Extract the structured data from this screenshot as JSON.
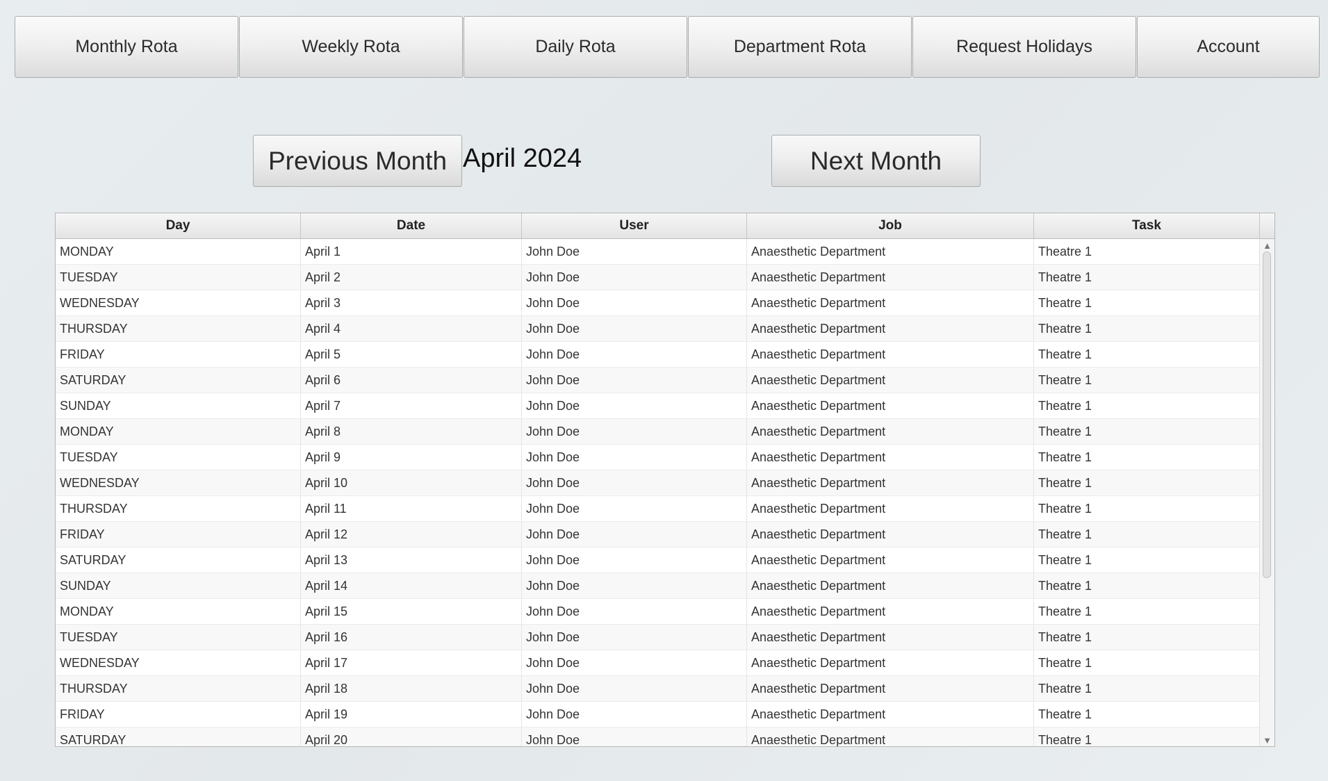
{
  "nav": {
    "tabs": [
      {
        "label": "Monthly Rota"
      },
      {
        "label": "Weekly Rota"
      },
      {
        "label": "Daily Rota"
      },
      {
        "label": "Department Rota"
      },
      {
        "label": "Request Holidays"
      },
      {
        "label": "Account"
      }
    ]
  },
  "month_nav": {
    "prev_label": "Previous Month",
    "current_month": "April 2024",
    "next_label": "Next Month"
  },
  "table": {
    "headers": {
      "day": "Day",
      "date": "Date",
      "user": "User",
      "job": "Job",
      "task": "Task"
    },
    "rows": [
      {
        "day": "MONDAY",
        "date": "April 1",
        "user": "John Doe",
        "job": "Anaesthetic Department",
        "task": "Theatre 1"
      },
      {
        "day": "TUESDAY",
        "date": "April 2",
        "user": "John Doe",
        "job": "Anaesthetic Department",
        "task": "Theatre 1"
      },
      {
        "day": "WEDNESDAY",
        "date": "April 3",
        "user": "John Doe",
        "job": "Anaesthetic Department",
        "task": "Theatre 1"
      },
      {
        "day": "THURSDAY",
        "date": "April 4",
        "user": "John Doe",
        "job": "Anaesthetic Department",
        "task": "Theatre 1"
      },
      {
        "day": "FRIDAY",
        "date": "April 5",
        "user": "John Doe",
        "job": "Anaesthetic Department",
        "task": "Theatre 1"
      },
      {
        "day": "SATURDAY",
        "date": "April 6",
        "user": "John Doe",
        "job": "Anaesthetic Department",
        "task": "Theatre 1"
      },
      {
        "day": "SUNDAY",
        "date": "April 7",
        "user": "John Doe",
        "job": "Anaesthetic Department",
        "task": "Theatre 1"
      },
      {
        "day": "MONDAY",
        "date": "April 8",
        "user": "John Doe",
        "job": "Anaesthetic Department",
        "task": "Theatre 1"
      },
      {
        "day": "TUESDAY",
        "date": "April 9",
        "user": "John Doe",
        "job": "Anaesthetic Department",
        "task": "Theatre 1"
      },
      {
        "day": "WEDNESDAY",
        "date": "April 10",
        "user": "John Doe",
        "job": "Anaesthetic Department",
        "task": "Theatre 1"
      },
      {
        "day": "THURSDAY",
        "date": "April 11",
        "user": "John Doe",
        "job": "Anaesthetic Department",
        "task": "Theatre 1"
      },
      {
        "day": "FRIDAY",
        "date": "April 12",
        "user": "John Doe",
        "job": "Anaesthetic Department",
        "task": "Theatre 1"
      },
      {
        "day": "SATURDAY",
        "date": "April 13",
        "user": "John Doe",
        "job": "Anaesthetic Department",
        "task": "Theatre 1"
      },
      {
        "day": "SUNDAY",
        "date": "April 14",
        "user": "John Doe",
        "job": "Anaesthetic Department",
        "task": "Theatre 1"
      },
      {
        "day": "MONDAY",
        "date": "April 15",
        "user": "John Doe",
        "job": "Anaesthetic Department",
        "task": "Theatre 1"
      },
      {
        "day": "TUESDAY",
        "date": "April 16",
        "user": "John Doe",
        "job": "Anaesthetic Department",
        "task": "Theatre 1"
      },
      {
        "day": "WEDNESDAY",
        "date": "April 17",
        "user": "John Doe",
        "job": "Anaesthetic Department",
        "task": "Theatre 1"
      },
      {
        "day": "THURSDAY",
        "date": "April 18",
        "user": "John Doe",
        "job": "Anaesthetic Department",
        "task": "Theatre 1"
      },
      {
        "day": "FRIDAY",
        "date": "April 19",
        "user": "John Doe",
        "job": "Anaesthetic Department",
        "task": "Theatre 1"
      },
      {
        "day": "SATURDAY",
        "date": "April 20",
        "user": "John Doe",
        "job": "Anaesthetic Department",
        "task": "Theatre 1"
      }
    ]
  },
  "scrollbar": {
    "up_icon": "chevron-up-icon",
    "down_icon": "chevron-down-icon"
  }
}
